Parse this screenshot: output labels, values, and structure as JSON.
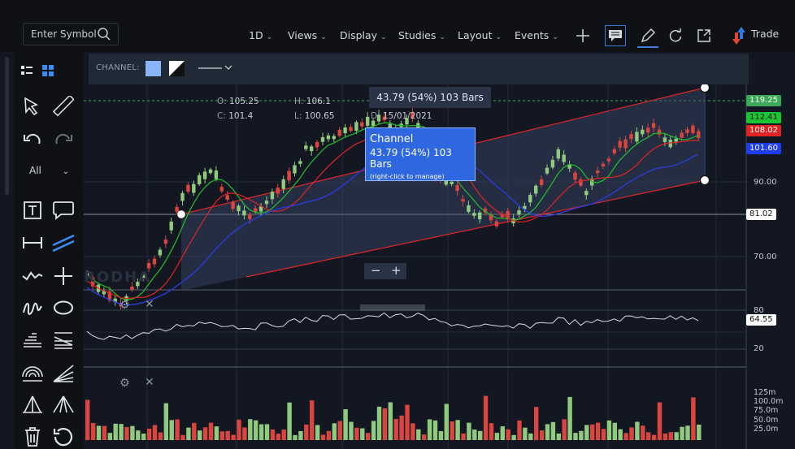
{
  "header": {
    "search_placeholder": "Enter Symbol",
    "menus": [
      {
        "label": "1D"
      },
      {
        "label": "Views"
      },
      {
        "label": "Display"
      },
      {
        "label": "Studies"
      },
      {
        "label": "Layout"
      },
      {
        "label": "Events"
      }
    ],
    "trade_label": "Trade"
  },
  "sidebar": {
    "filter_label": "All"
  },
  "drawing_toolbar": {
    "label": "CHANNEL:",
    "fill_color": "#8ab4f8"
  },
  "ohlc": {
    "open_label": "O:",
    "open": "105.25",
    "high_label": "H:",
    "high": "106.1",
    "close_label": "C:",
    "close": "101.4",
    "low_label": "L:",
    "low": "100.65",
    "date_label": "D:",
    "date": "15/01/2021"
  },
  "measure": {
    "text": "43.79 (54%) 103 Bars"
  },
  "tooltip": {
    "title": "Channel",
    "detail": "43.79 (54%) 103 Bars",
    "hint": "(right-click to manage)"
  },
  "price_axis": {
    "labels": [
      "90.00",
      "70.00"
    ],
    "channel_tag": "81.02",
    "tags": [
      {
        "value": "119.25",
        "color": "#3aa856"
      },
      {
        "value": "112.41",
        "color": "#19c532"
      },
      {
        "value": "108.02",
        "color": "#e02424"
      },
      {
        "value": "101.60",
        "color": "#1f3df0"
      }
    ]
  },
  "oscillator_axis": {
    "upper": "80",
    "lower": "20",
    "value": "64.55"
  },
  "volume_axis": {
    "labels": [
      "125m",
      "100.0m",
      "75.0m",
      "50.0m",
      "25.0m"
    ]
  },
  "watermark": "RODHA",
  "colors": {
    "up": "#8fca7e",
    "down": "#d9453f",
    "channel": "#e0262b",
    "ma_green": "#22c02a",
    "ma_red": "#e02424",
    "ma_blue": "#2b3bd8"
  },
  "icons": [
    "search-icon",
    "plus-icon",
    "comment-icon",
    "pencil-icon",
    "refresh-icon",
    "popout-icon",
    "trade-arrows-icon",
    "list-view-icon",
    "grid-view-icon",
    "cursor-icon",
    "ruler-icon",
    "undo-icon",
    "redo-icon",
    "text-tool-icon",
    "callout-icon",
    "horizontal-line-icon",
    "trend-line-icon",
    "wave-icon",
    "crosshair-icon",
    "freehand-icon",
    "ellipse-icon",
    "fib-retracement-icon",
    "fib-extension-icon",
    "arc-icon",
    "fan-icon",
    "pitchfork-icon",
    "pitchfork-alt-icon",
    "trash-icon",
    "reset-icon",
    "gear-icon",
    "close-icon"
  ]
}
